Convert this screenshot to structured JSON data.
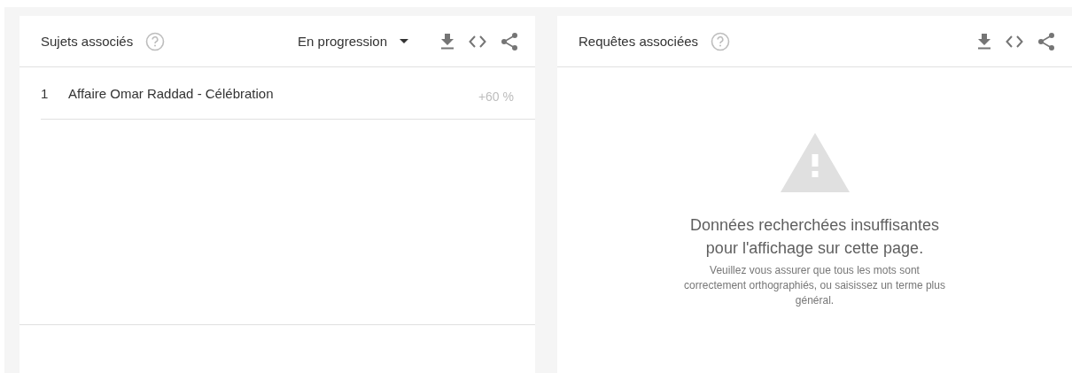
{
  "panels": [
    {
      "kind": "list",
      "title": "Sujets associés",
      "dropdown": {
        "value": "En progression"
      },
      "rows": [
        {
          "rank": "1",
          "label": "Affaire Omar Raddad - Célébration",
          "value": "+60 %"
        }
      ]
    },
    {
      "kind": "empty",
      "title": "Requêtes associées",
      "empty_state": {
        "heading": "Données recherchées insuffisantes pour l'affichage sur cette page.",
        "message": "Veuillez vous assurer que tous les mots sont correctement orthographiés, ou saisissez un terme plus général."
      }
    }
  ]
}
